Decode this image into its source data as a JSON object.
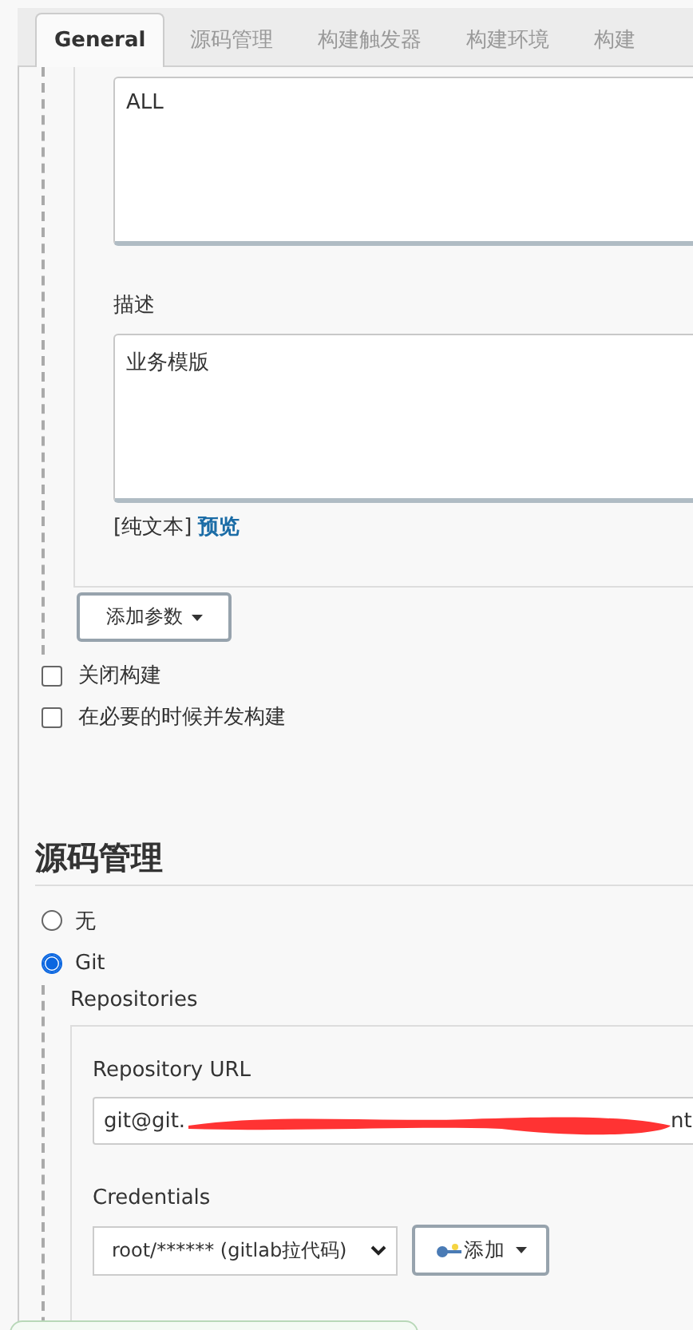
{
  "tabs": [
    {
      "label": "General",
      "selected": true
    },
    {
      "label": "源码管理",
      "selected": false
    },
    {
      "label": "构建触发器",
      "selected": false
    },
    {
      "label": "构建环境",
      "selected": false
    },
    {
      "label": "构建",
      "selected": false
    }
  ],
  "parameter": {
    "default_value": "ALL",
    "description_label": "描述",
    "description": "业务模版",
    "format_label": "[纯文本]",
    "preview_link": "预览"
  },
  "add_parameter_button": "添加参数",
  "options": [
    {
      "label": "关闭构建",
      "checked": false
    },
    {
      "label": "在必要的时候并发构建",
      "checked": false
    }
  ],
  "scm": {
    "heading": "源码管理",
    "choices": [
      {
        "label": "无",
        "selected": false
      },
      {
        "label": "Git",
        "selected": true
      }
    ],
    "repositories_label": "Repositories",
    "repository_url_label": "Repository URL",
    "repository_url": "git@git.",
    "repository_url_tail": "nt",
    "credentials_label": "Credentials",
    "credentials": "root/****** (gitlab拉代码)",
    "add_button": "添加"
  }
}
